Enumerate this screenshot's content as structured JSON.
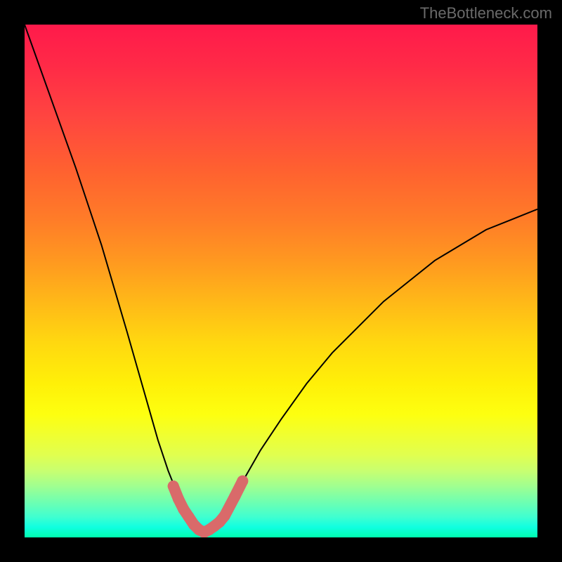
{
  "watermark": "TheBottleneck.com",
  "chart_data": {
    "type": "line",
    "title": "",
    "xlabel": "",
    "ylabel": "",
    "xlim": [
      0,
      100
    ],
    "ylim": [
      0,
      100
    ],
    "grid": false,
    "legend": false,
    "background_gradient": [
      "#ff1a4b",
      "#00ffb0"
    ],
    "series": [
      {
        "name": "bottleneck-curve",
        "x": [
          0,
          5,
          10,
          15,
          20,
          22,
          24,
          26,
          28,
          30,
          31,
          32,
          33,
          34,
          35,
          36,
          37,
          38,
          40,
          42,
          46,
          50,
          55,
          60,
          65,
          70,
          75,
          80,
          85,
          90,
          95,
          100
        ],
        "y": [
          100,
          86,
          72,
          57,
          40,
          33,
          26,
          19,
          13,
          8,
          6,
          4,
          2.5,
          1.5,
          1,
          1.5,
          2.2,
          3,
          6,
          10,
          17,
          23,
          30,
          36,
          41,
          46,
          50,
          54,
          57,
          60,
          62,
          64
        ],
        "color": "#000000"
      }
    ],
    "markers": {
      "name": "highlight-segment",
      "color": "#d96a6a",
      "points_xy": [
        [
          29,
          10
        ],
        [
          30,
          7.5
        ],
        [
          31,
          5.5
        ],
        [
          32,
          4
        ],
        [
          33,
          2.5
        ],
        [
          34,
          1.5
        ],
        [
          35,
          1
        ],
        [
          36,
          1.5
        ],
        [
          37,
          2.2
        ],
        [
          38,
          3
        ],
        [
          39,
          4.2
        ],
        [
          41,
          8
        ],
        [
          42.5,
          11
        ]
      ]
    }
  }
}
